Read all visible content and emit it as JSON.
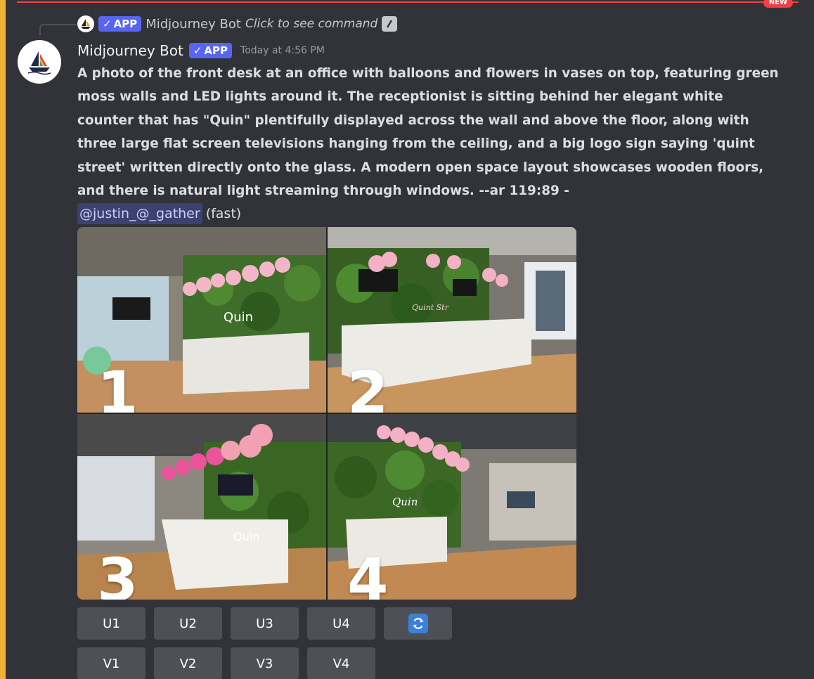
{
  "new_divider": {
    "label": "NEW"
  },
  "reply": {
    "app_tag": "APP",
    "author": "Midjourney Bot",
    "command_text": "Click to see command"
  },
  "message": {
    "author": "Midjourney Bot",
    "app_tag": "APP",
    "timestamp": "Today at 4:56 PM",
    "prompt": "A photo of the front desk at an office with balloons and flowers in vases on top, featuring green moss walls and LED lights around it. The receptionist is sitting behind her elegant white counter that has \"Quin\" plentifully displayed across the wall and above the floor, along with three large flat screen televisions hanging from the ceiling, and a big logo sign saying 'quint street' written directly onto the glass. A modern open space layout showcases wooden floors, and there is natural light streaming through windows. --ar 119:89 -",
    "mention": "@justin_@_gather",
    "speed": "(fast)"
  },
  "grid": {
    "tiles": [
      {
        "number": "1",
        "sign": "Quin"
      },
      {
        "number": "2",
        "sign": "Quint Str"
      },
      {
        "number": "3",
        "sign": "Quin"
      },
      {
        "number": "4",
        "sign": "Quin"
      }
    ]
  },
  "buttons": {
    "upscale": [
      "U1",
      "U2",
      "U3",
      "U4"
    ],
    "variation": [
      "V1",
      "V2",
      "V3",
      "V4"
    ],
    "reroll_icon": "refresh-icon"
  },
  "colors": {
    "background": "#313338",
    "accent": "#5865f2",
    "button": "#4e5058",
    "mention_bar": "#f0b232",
    "new_divider": "#f23f43"
  }
}
